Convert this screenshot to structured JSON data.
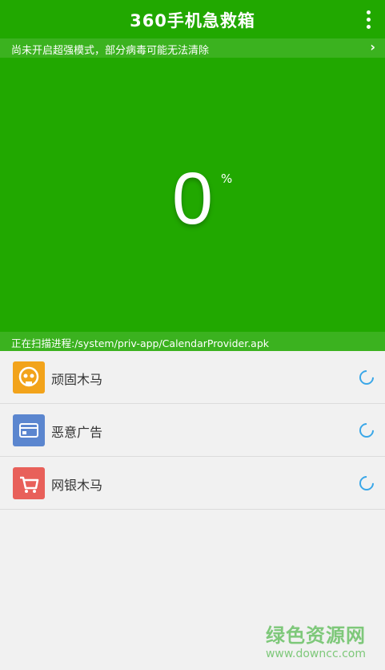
{
  "header": {
    "title": "360手机急救箱",
    "menu_icon": "vertical-dots-icon"
  },
  "banner": {
    "text": "尚未开启超强模式，部分病毒可能无法清除",
    "arrow_icon": "chevron-right-icon"
  },
  "progress": {
    "value": "0",
    "unit": "%"
  },
  "scan_status": {
    "text": "正在扫描进程:/system/priv-app/CalendarProvider.apk"
  },
  "scan_items": [
    {
      "label": "顽固木马",
      "icon": "skull-icon",
      "color": "#f2a31b",
      "status_icon": "loading-spinner-icon"
    },
    {
      "label": "恶意广告",
      "icon": "ad-card-icon",
      "color": "#5b86cf",
      "status_icon": "loading-spinner-icon"
    },
    {
      "label": "网银木马",
      "icon": "shopping-cart-icon",
      "color": "#e8605a",
      "status_icon": "loading-spinner-icon"
    }
  ],
  "watermark": {
    "title": "绿色资源网",
    "url": "www.downcc.com"
  },
  "colors": {
    "primary_green": "#21a800",
    "banner_green": "#3bb21f",
    "spinner_blue": "#3aa7e8"
  }
}
